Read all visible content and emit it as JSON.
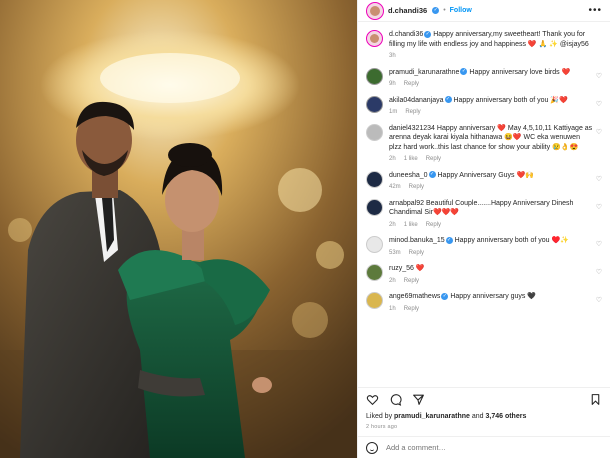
{
  "header": {
    "username": "d.chandi36",
    "separator": "•",
    "follow_label": "Follow",
    "more_label": "•••"
  },
  "caption": {
    "username": "d.chandi36",
    "text": "Happy anniversary,my sweetheart! Thank you for filling my life with endless joy and happiness ❤️ 🙏 ✨ @isjay56",
    "time": "3h"
  },
  "comments": [
    {
      "username": "pramudi_karunarathne",
      "verified": true,
      "text": "Happy anniversary love birds ❤️",
      "time": "9h",
      "likes": "",
      "reply": "Reply"
    },
    {
      "username": "akila04dananjaya",
      "verified": true,
      "text": "Happy anniversary both of you 🎉❤️",
      "time": "1m",
      "likes": "",
      "reply": "Reply"
    },
    {
      "username": "daniel4321234",
      "verified": false,
      "text": "Happy anniversary ❤️ May 4,5,10,11 Kattiyage as arenna deyak karai kiyala hithanawa 😆❤️ WC eka wenuwen plzz hard work..this last chance for show your ability 😢👌😍",
      "time": "2h",
      "likes": "1 like",
      "reply": "Reply"
    },
    {
      "username": "duneesha_0",
      "verified": true,
      "text": "Happy Anniversary Guys ❤️🙌",
      "time": "42m",
      "likes": "",
      "reply": "Reply"
    },
    {
      "username": "arnabpal92",
      "verified": false,
      "text": "Beautiful Couple.......Happy Anniversary Dinesh Chandimal Sir❤️❤️❤️",
      "time": "2h",
      "likes": "1 like",
      "reply": "Reply"
    },
    {
      "username": "minod.banuka_15",
      "verified": true,
      "text": "Happy anniversary both of you ♥️✨",
      "time": "53m",
      "likes": "",
      "reply": "Reply"
    },
    {
      "username": "ruzy_56",
      "verified": false,
      "text": "❤️",
      "time": "2h",
      "likes": "",
      "reply": "Reply"
    },
    {
      "username": "ange69mathews",
      "verified": true,
      "text": "Happy anniversary guys 🖤",
      "time": "1h",
      "likes": "",
      "reply": "Reply"
    }
  ],
  "liked_by": {
    "prefix": "Liked by",
    "user": "pramudi_karunarathne",
    "conjunction": "and",
    "count": "3,746 others"
  },
  "post_time": "2 hours ago",
  "add_comment_placeholder": "Add a comment…",
  "icons": [
    "heart-icon",
    "comment-icon",
    "share-icon",
    "bookmark-icon",
    "emoji-icon",
    "more-icon",
    "verified-icon"
  ],
  "colors": {
    "accent": "#0095f6",
    "like_red": "#ed4956",
    "muted": "#8e8e8e",
    "verified": "#3897f0"
  }
}
